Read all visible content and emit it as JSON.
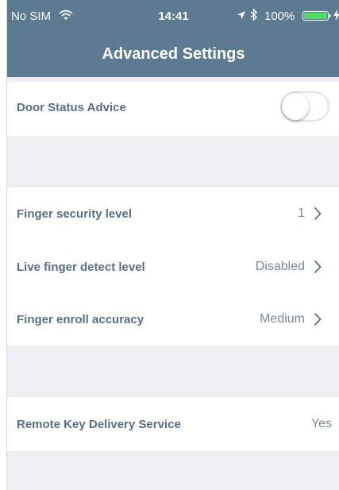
{
  "status_bar": {
    "carrier": "No SIM",
    "time": "14:41",
    "battery_percent": "100%"
  },
  "header": {
    "title": "Advanced Settings"
  },
  "settings": {
    "door_status": {
      "label": "Door Status Advice",
      "enabled": false
    },
    "finger_security": {
      "label": "Finger security level",
      "value": "1"
    },
    "live_finger": {
      "label": "Live finger detect level",
      "value": "Disabled"
    },
    "finger_enroll": {
      "label": "Finger enroll accuracy",
      "value": "Medium"
    },
    "remote_key": {
      "label": "Remote Key Delivery Service",
      "value": "Yes"
    }
  },
  "colors": {
    "header_bg": "#5d7b90",
    "label_text": "#5b6f82",
    "value_text": "#7b8a97",
    "battery_fill": "#4cd964"
  },
  "icons": [
    "wifi-icon",
    "location-arrow-icon",
    "bluetooth-icon",
    "battery-icon",
    "charging-bolt-icon",
    "chevron-right-icon"
  ]
}
